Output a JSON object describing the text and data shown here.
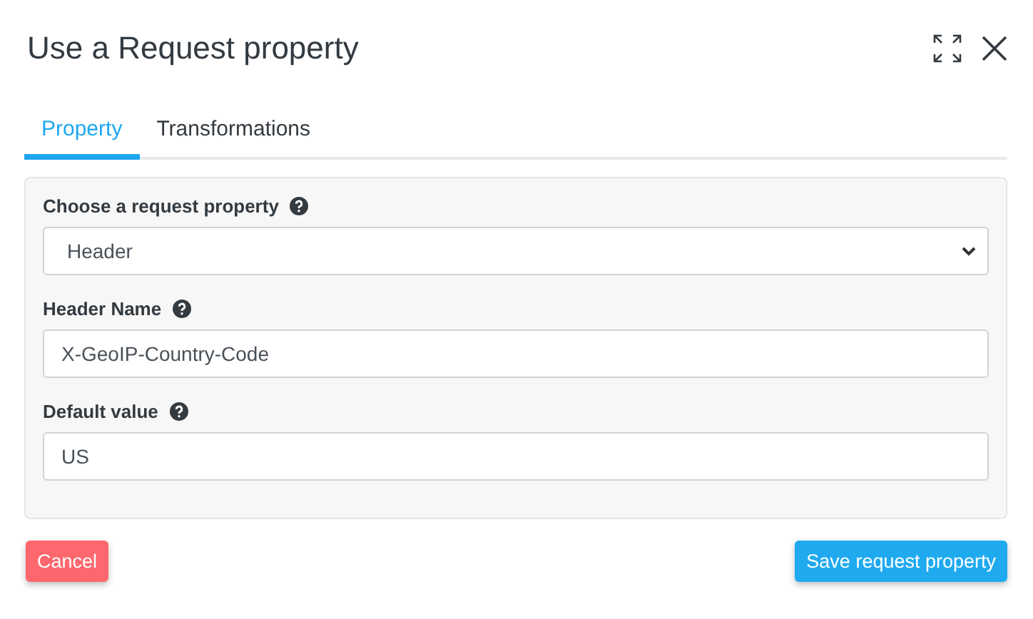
{
  "dialog": {
    "title": "Use a Request property"
  },
  "tabs": [
    {
      "label": "Property",
      "selected": true
    },
    {
      "label": "Transformations",
      "selected": false
    }
  ],
  "fields": [
    {
      "kind": "select",
      "label": "Choose a request property",
      "value": "Header"
    },
    {
      "kind": "text",
      "label": "Header Name",
      "value": "X-GeoIP-Country-Code"
    },
    {
      "kind": "text",
      "label": "Default value",
      "value": "US"
    }
  ],
  "buttons": [
    {
      "kind": "danger",
      "label": "Cancel"
    },
    {
      "kind": "primary",
      "label": "Save request property"
    }
  ]
}
